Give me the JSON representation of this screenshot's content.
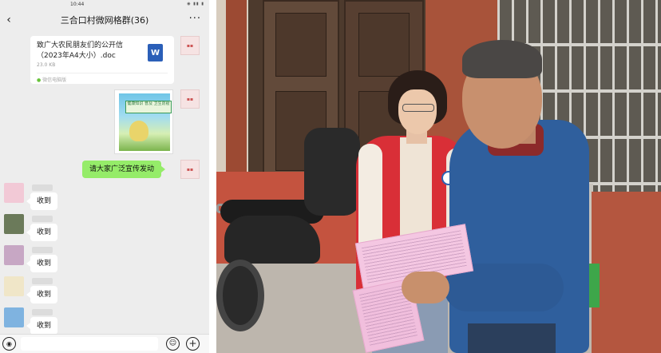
{
  "status_bar": {
    "time": "10:44",
    "indicators": "◉ ▮▮ ▮"
  },
  "header": {
    "title": "三合口村微网格群(36)",
    "more": "···",
    "back": "‹"
  },
  "file_message": {
    "filename": "致广大农民朋友们的公开信（2023年A4大小）.doc",
    "size": "23.0 KB",
    "source": "微信电脑版",
    "type_letter": "W"
  },
  "image_message": {
    "banner": "健康知识 普及 卫生防疫"
  },
  "sent_text": "请大家广泛宣传发动",
  "received_replies": [
    "收到",
    "收到",
    "收到",
    "收到",
    "收到"
  ],
  "avatar_colors": [
    "#f2c9d6",
    "#6b7a5a",
    "#c7a7c4",
    "#f0e6c8",
    "#7fb3e0"
  ],
  "input_bar": {
    "voice": "◉",
    "emoji": "☺",
    "plus": "+"
  }
}
